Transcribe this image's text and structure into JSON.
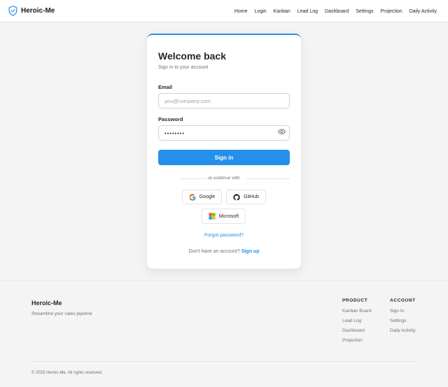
{
  "brand": {
    "name": "Heroic-Me",
    "accent": "#2590ea"
  },
  "nav": [
    "Home",
    "Login",
    "Kanban",
    "Lead Log",
    "Dashboard",
    "Settings",
    "Projection",
    "Daily Activity"
  ],
  "card": {
    "title": "Welcome back",
    "subtitle": "Sign in to your account",
    "email_label": "Email",
    "email_placeholder": "you@company.com",
    "password_label": "Password",
    "password_value": "••••••••",
    "submit_label": "Sign in",
    "divider_text": "or continue with",
    "providers": [
      {
        "label": "Google",
        "icon": "google-icon"
      },
      {
        "label": "GitHub",
        "icon": "github-icon"
      },
      {
        "label": "Microsoft",
        "icon": "microsoft-icon"
      }
    ],
    "forgot_label": "Forgot password?",
    "signup_prompt": "Don't have an account?",
    "signup_link": "Sign up"
  },
  "footer": {
    "brand": "Heroic-Me",
    "tagline": "Streamline your sales pipeline",
    "product_heading": "PRODUCT",
    "product_links": [
      "Kanban Board",
      "Lead Log",
      "Dashboard",
      "Projection"
    ],
    "account_heading": "ACCOUNT",
    "account_links": [
      "Sign In",
      "Settings",
      "Daily Activity"
    ],
    "copyright": "© 2025 Heroic-Me. All rights reserved."
  }
}
